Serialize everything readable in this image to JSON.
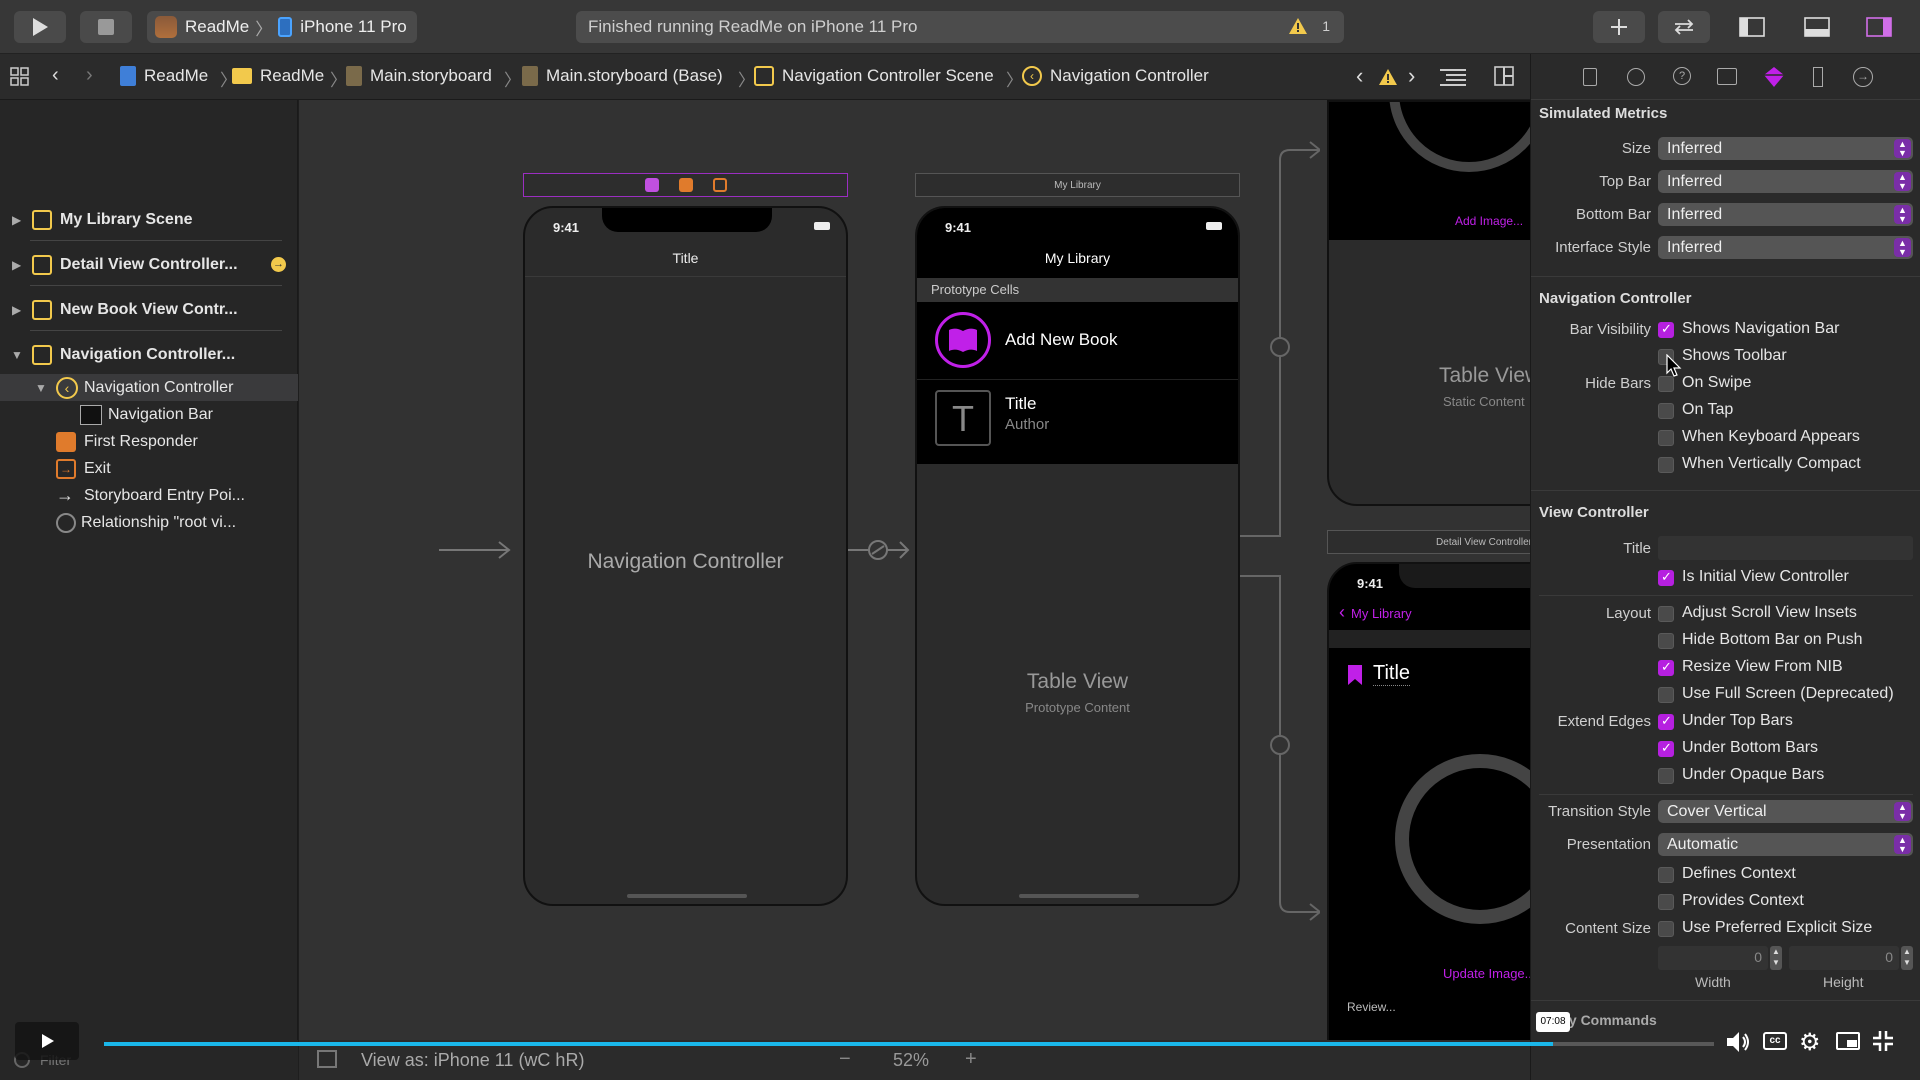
{
  "toolbar": {
    "scheme_project": "ReadMe",
    "scheme_device": "iPhone 11 Pro",
    "status_text": "Finished running ReadMe on iPhone 11 Pro",
    "warning_count": "1"
  },
  "jumpbar": {
    "crumbs": [
      "ReadMe",
      "ReadMe",
      "Main.storyboard",
      "Main.storyboard (Base)",
      "Navigation Controller Scene",
      "Navigation Controller"
    ]
  },
  "navigator": {
    "items": [
      {
        "label": "My Library Scene"
      },
      {
        "label": "Detail View Controller..."
      },
      {
        "label": "New Book View Contr..."
      },
      {
        "label": "Navigation Controller..."
      },
      {
        "label": "Navigation Controller"
      },
      {
        "label": "Navigation Bar"
      },
      {
        "label": "First Responder"
      },
      {
        "label": "Exit"
      },
      {
        "label": "Storyboard Entry Poi..."
      },
      {
        "label": "Relationship \"root vi..."
      }
    ]
  },
  "canvas": {
    "nav_scene": {
      "time": "9:41",
      "nav_title": "Title",
      "center_label": "Navigation Controller"
    },
    "library_scene": {
      "header": "My Library",
      "time": "9:41",
      "nav_title": "My Library",
      "section": "Prototype Cells",
      "cell1": "Add New Book",
      "cell2_title": "Title",
      "cell2_sub": "Author",
      "cell2_glyph": "T",
      "table_label": "Table View",
      "table_sub": "Prototype Content"
    },
    "right_top": {
      "link": "Add Image...",
      "table_label": "Table View",
      "table_sub": "Static Content"
    },
    "detail_scene": {
      "header": "Detail View Controller",
      "time": "9:41",
      "back": "My Library",
      "title": "Title",
      "link": "Update Image...",
      "review": "Review..."
    }
  },
  "inspector": {
    "simulated_metrics": {
      "title": "Simulated Metrics",
      "rows": [
        {
          "label": "Size",
          "value": "Inferred"
        },
        {
          "label": "Top Bar",
          "value": "Inferred"
        },
        {
          "label": "Bottom Bar",
          "value": "Inferred"
        },
        {
          "label": "Interface Style",
          "value": "Inferred"
        }
      ]
    },
    "navigation_controller": {
      "title": "Navigation Controller",
      "bar_visibility_label": "Bar Visibility",
      "hide_bars_label": "Hide Bars",
      "shows_navigation_bar": "Shows Navigation Bar",
      "shows_toolbar": "Shows Toolbar",
      "on_swipe": "On Swipe",
      "on_tap": "On Tap",
      "when_keyboard": "When Keyboard Appears",
      "when_compact": "When Vertically Compact"
    },
    "view_controller": {
      "title": "View Controller",
      "title_label": "Title",
      "is_initial": "Is Initial View Controller",
      "layout_label": "Layout",
      "adjust_scroll": "Adjust Scroll View Insets",
      "hide_bottom": "Hide Bottom Bar on Push",
      "resize_nib": "Resize View From NIB",
      "full_screen": "Use Full Screen (Deprecated)",
      "extend_label": "Extend Edges",
      "under_top": "Under Top Bars",
      "under_bottom": "Under Bottom Bars",
      "under_opaque": "Under Opaque Bars",
      "transition_label": "Transition Style",
      "transition_value": "Cover Vertical",
      "presentation_label": "Presentation",
      "presentation_value": "Automatic",
      "defines_context": "Defines Context",
      "provides_context": "Provides Context",
      "content_size_label": "Content Size",
      "preferred_size": "Use Preferred Explicit Size",
      "width_value": "0",
      "height_value": "0",
      "width_label": "Width",
      "height_label": "Height",
      "key_commands": "Key Commands"
    }
  },
  "bottom": {
    "view_as": "View as: iPhone 11 (wC hR)",
    "zoom": "52%",
    "filter_placeholder": "Filter",
    "video_time": "07:08",
    "video_progress": 0.9
  },
  "colors": {
    "accent": "#b620e0",
    "warning": "#f2c94c"
  }
}
